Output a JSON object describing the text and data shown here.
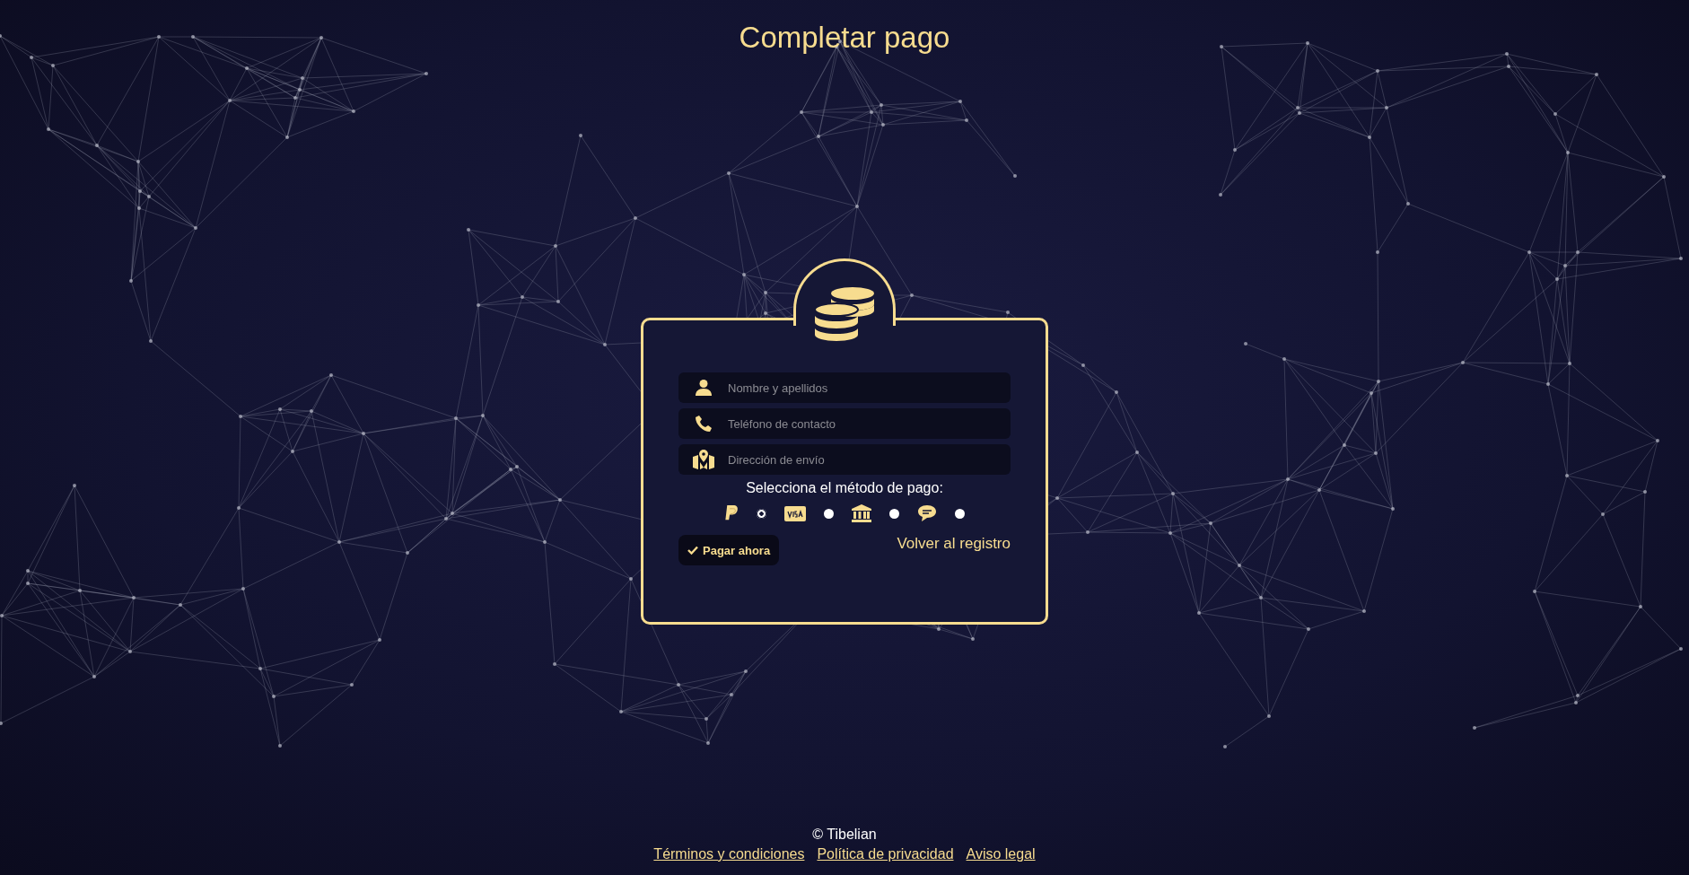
{
  "title": "Completar pago",
  "fields": [
    {
      "kind": "person",
      "placeholder": "Nombre y apellidos"
    },
    {
      "kind": "phone",
      "placeholder": "Teléfono de contacto"
    },
    {
      "kind": "map",
      "placeholder": "Dirección de envío"
    }
  ],
  "payment": {
    "label": "Selecciona el método de pago:",
    "methods": [
      {
        "kind": "paypal",
        "selected": true
      },
      {
        "kind": "visa",
        "selected": false
      },
      {
        "kind": "bank",
        "selected": false
      },
      {
        "kind": "sms",
        "selected": false
      }
    ]
  },
  "submit": {
    "label": "Pagar ahora"
  },
  "back_link": "Volver al registro",
  "footer": {
    "copyright": "© Tibelian",
    "links": [
      "Términos y condiciones",
      "Política de privacidad",
      "Aviso legal"
    ]
  }
}
